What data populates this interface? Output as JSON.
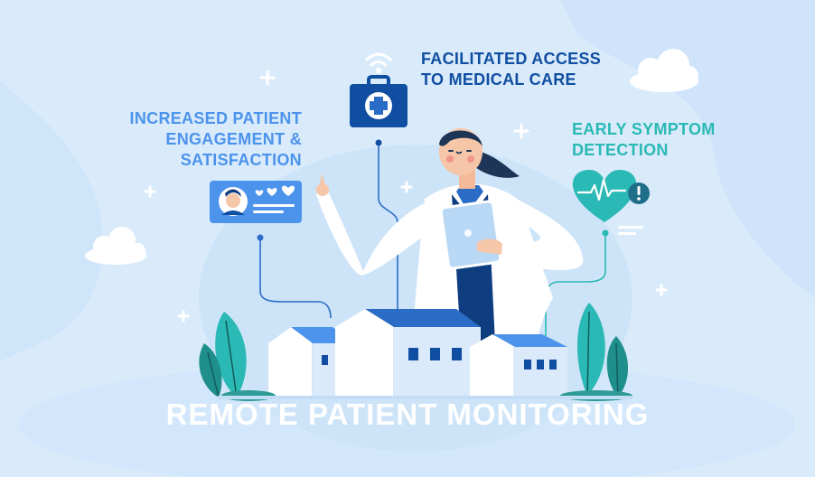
{
  "title": "REMOTE PATIENT MONITORING",
  "benefits": {
    "access": {
      "line1": "FACILITATED ACCESS",
      "line2": "TO MEDICAL CARE"
    },
    "engagement": {
      "line1": "INCREASED PATIENT",
      "line2": "ENGAGEMENT &",
      "line3": "SATISFACTION"
    },
    "symptom": {
      "line1": "EARLY SYMPTOM",
      "line2": "DETECTION"
    }
  },
  "icons": [
    "medical-kit-icon",
    "wifi-icon",
    "patient-card-icon",
    "heartbeat-icon",
    "alert-icon",
    "cloud-icon",
    "plus-sparkle-icon"
  ],
  "colors": {
    "background": "#d9ebfb",
    "navy": "#0f4ea1",
    "blue": "#4c93ec",
    "teal": "#2ab9b4",
    "white": "#ffffff"
  }
}
